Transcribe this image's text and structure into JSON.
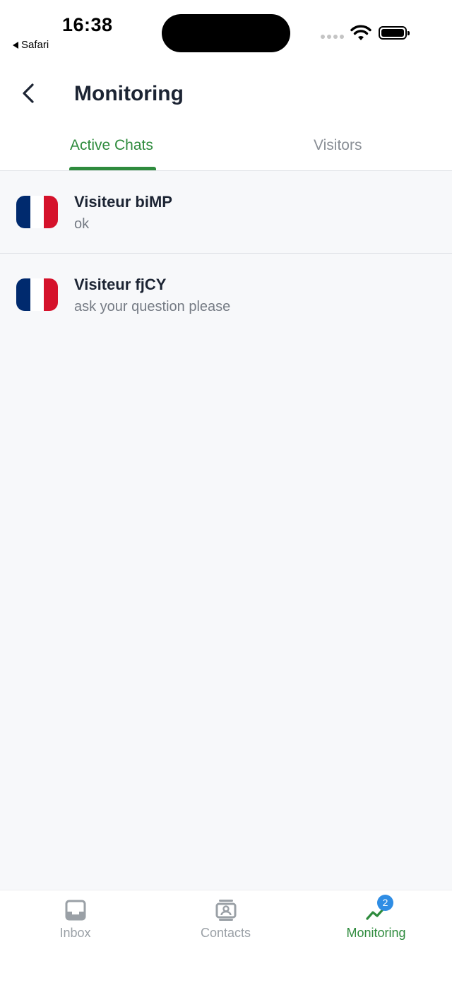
{
  "status_bar": {
    "time": "16:38",
    "back_app": "Safari"
  },
  "header": {
    "title": "Monitoring"
  },
  "tabs": [
    {
      "label": "Active Chats",
      "active": true
    },
    {
      "label": "Visitors",
      "active": false
    }
  ],
  "chats": [
    {
      "name": "Visiteur biMP",
      "preview": "ok",
      "flag": "france-flag-icon"
    },
    {
      "name": "Visiteur fjCY",
      "preview": "ask your question please",
      "flag": "france-flag-icon"
    }
  ],
  "bottom_nav": {
    "inbox": {
      "label": "Inbox",
      "icon": "inbox-icon"
    },
    "contacts": {
      "label": "Contacts",
      "icon": "contacts-icon"
    },
    "monitoring": {
      "label": "Monitoring",
      "icon": "trend-icon",
      "badge": "2"
    }
  },
  "colors": {
    "accent": "#2e8b3d",
    "badge": "#2f8de4",
    "inactive": "#9aa0a6"
  }
}
